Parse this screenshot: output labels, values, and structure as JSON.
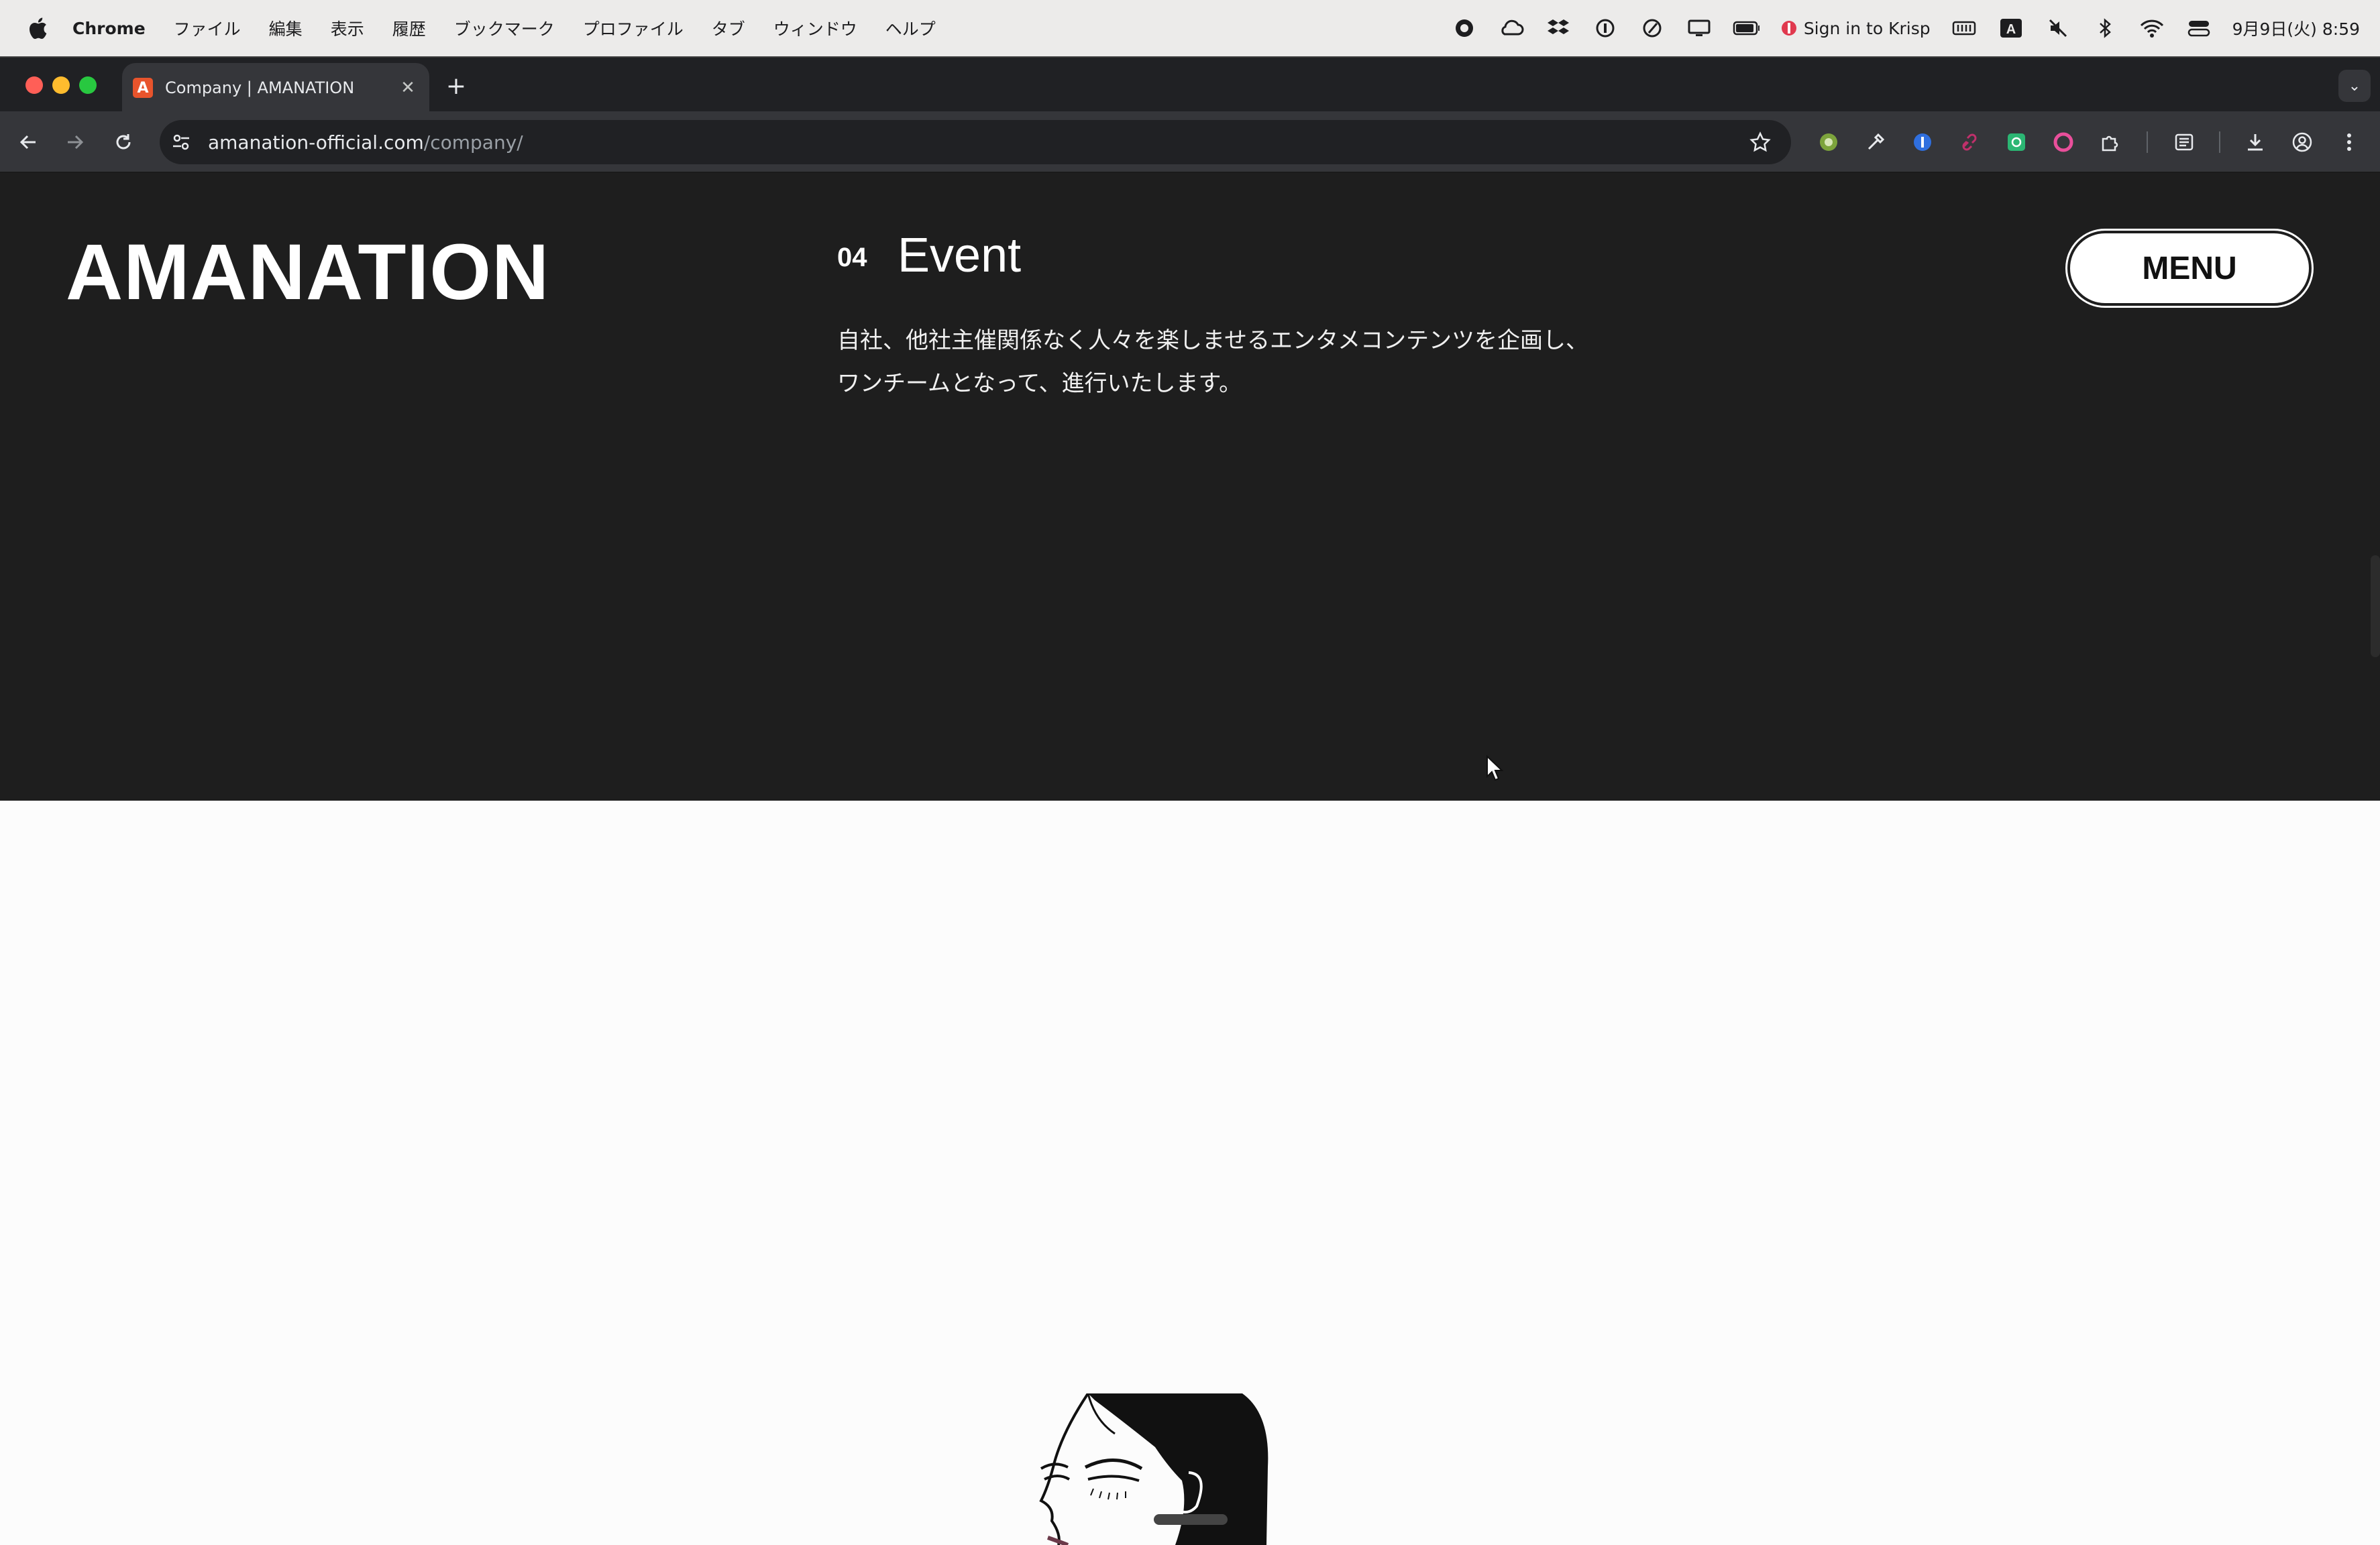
{
  "menubar": {
    "app": "Chrome",
    "items": [
      "ファイル",
      "編集",
      "表示",
      "履歴",
      "ブックマーク",
      "プロファイル",
      "タブ",
      "ウィンドウ",
      "ヘルプ"
    ],
    "krisp": "Sign in to Krisp",
    "clock": "9月9日(火) 8:59"
  },
  "browser": {
    "tab_title": "Company | AMANATION",
    "url_host": "amanation-official.com",
    "url_path": "/company/"
  },
  "page": {
    "logo": "AMANATION",
    "section_number": "04",
    "section_title": "Event",
    "section_body_line1": "自社、他社主催関係なく人々を楽しませるエンタメコンテンツを企画し、",
    "section_body_line2": "ワンチームとなって、進行いたします。",
    "menu_label": "MENU"
  },
  "colors": {
    "dark_bg": "#1e1e1e",
    "page_bg": "#fcfcfc",
    "favicon": "#e8542c"
  }
}
